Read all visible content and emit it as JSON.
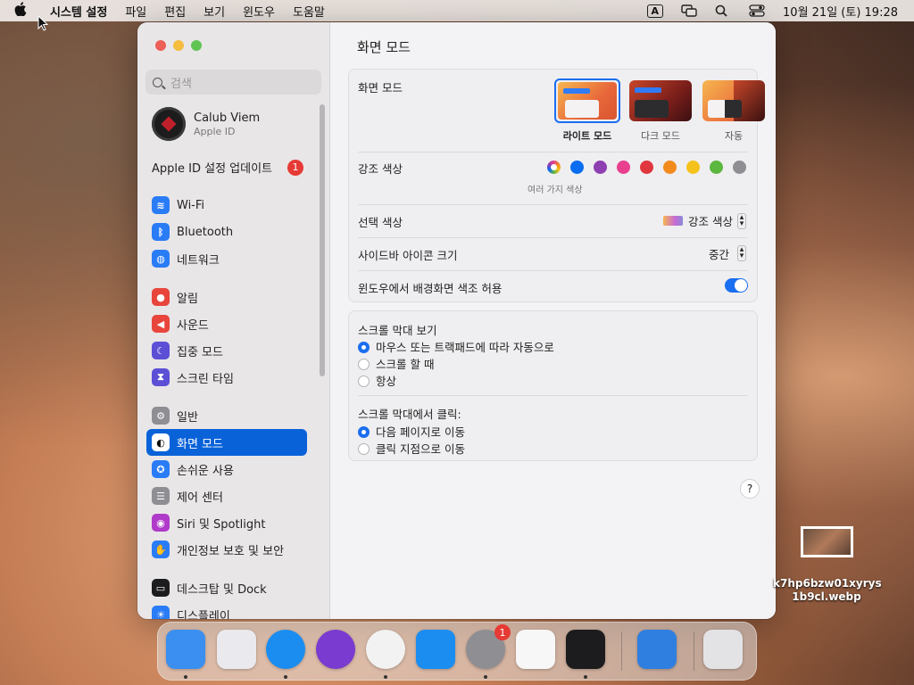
{
  "menubar": {
    "app_name": "시스템 설정",
    "menus": [
      "파일",
      "편집",
      "보기",
      "윈도우",
      "도움말"
    ],
    "keyboard_badge": "A",
    "clock": "10월 21일 (토) 19:28"
  },
  "sidebar": {
    "search_placeholder": "검색",
    "user": {
      "name": "Calub Viem",
      "sub": "Apple ID"
    },
    "update": {
      "label": "Apple ID 설정 업데이트",
      "badge": "1"
    },
    "items": [
      {
        "label": "Wi-Fi",
        "icon": "wifi-icon",
        "color": "#2a7cf6",
        "glyph": "≋"
      },
      {
        "label": "Bluetooth",
        "icon": "bluetooth-icon",
        "color": "#2a7cf6",
        "glyph": "ᛒ"
      },
      {
        "label": "네트워크",
        "icon": "network-icon",
        "color": "#2a7cf6",
        "glyph": "◍"
      },
      {
        "label": "알림",
        "icon": "notifications-icon",
        "color": "#e8453c",
        "glyph": "●"
      },
      {
        "label": "사운드",
        "icon": "sound-icon",
        "color": "#e8453c",
        "glyph": "◀"
      },
      {
        "label": "집중 모드",
        "icon": "focus-icon",
        "color": "#5c4fd6",
        "glyph": "☾"
      },
      {
        "label": "스크린 타임",
        "icon": "screen-time-icon",
        "color": "#5c4fd6",
        "glyph": "⧗"
      },
      {
        "label": "일반",
        "icon": "general-icon",
        "color": "#8e8e93",
        "glyph": "⚙"
      },
      {
        "label": "화면 모드",
        "icon": "appearance-icon",
        "color": "#111111",
        "glyph": "◐"
      },
      {
        "label": "손쉬운 사용",
        "icon": "accessibility-icon",
        "color": "#2a7cf6",
        "glyph": "✪"
      },
      {
        "label": "제어 센터",
        "icon": "control-center-icon",
        "color": "#8e8e93",
        "glyph": "☰"
      },
      {
        "label": "Siri 및 Spotlight",
        "icon": "siri-icon",
        "color": "#b03ac9",
        "glyph": "◉"
      },
      {
        "label": "개인정보 보호 및 보안",
        "icon": "privacy-icon",
        "color": "#2a7cf6",
        "glyph": "✋"
      },
      {
        "label": "데스크탑 및 Dock",
        "icon": "desktop-dock-icon",
        "color": "#1c1c1e",
        "glyph": "▭"
      },
      {
        "label": "디스플레이",
        "icon": "displays-icon",
        "color": "#2a7cf6",
        "glyph": "☀"
      }
    ],
    "active_index": 8
  },
  "content": {
    "title": "화면 모드",
    "appearance": {
      "label": "화면 모드",
      "options": [
        {
          "label": "라이트 모드",
          "selected": true
        },
        {
          "label": "다크 모드",
          "selected": false
        },
        {
          "label": "자동",
          "selected": false
        }
      ]
    },
    "accent": {
      "label": "강조 색상",
      "caption": "여러 가지 색상",
      "colors": [
        "multicolor",
        "#0a6cf0",
        "#8e3fb0",
        "#e83f8e",
        "#e0363d",
        "#f28b1c",
        "#f4c21b",
        "#5bb73f",
        "#8e8e93"
      ]
    },
    "highlight": {
      "label": "선택 색상",
      "value": "강조 색상"
    },
    "sidebar_icon_size": {
      "label": "사이드바 아이콘 크기",
      "value": "중간"
    },
    "wallpaper_tint": {
      "label": "윈도우에서 배경화면 색조 허용",
      "enabled": true
    },
    "scrollbars": {
      "label": "스크롤 막대 보기",
      "options": [
        "마우스 또는 트랙패드에 따라 자동으로",
        "스크롤 할 때",
        "항상"
      ],
      "selected": 0
    },
    "click_scrollbar": {
      "label": "스크롤 막대에서 클릭:",
      "options": [
        "다음 페이지로 이동",
        "클릭 지점으로 이동"
      ],
      "selected": 0
    },
    "help": "?"
  },
  "desktop_file": {
    "name_line1": "k7hp6bzw01xyrys",
    "name_line2": "1b9cl.webp"
  },
  "dock": {
    "apps": [
      {
        "name": "finder-icon",
        "color": "#3a8ff0",
        "running": true
      },
      {
        "name": "launchpad-icon",
        "color": "#e9e9ee",
        "running": false
      },
      {
        "name": "safari-icon",
        "color": "#1b8df0",
        "running": true
      },
      {
        "name": "firefox-icon",
        "color": "#7a3bd0",
        "running": false
      },
      {
        "name": "chrome-icon",
        "color": "#f2f2f2",
        "running": true
      },
      {
        "name": "app-store-icon",
        "color": "#1b8df0",
        "running": false
      },
      {
        "name": "system-settings-icon",
        "color": "#8e8e93",
        "running": true,
        "badge": "1"
      },
      {
        "name": "textedit-icon",
        "color": "#f7f7f7",
        "running": false
      },
      {
        "name": "terminal-icon",
        "color": "#1c1c1e",
        "running": true
      },
      {
        "name": "weather-icon",
        "color": "#2f7fe0",
        "running": false
      },
      {
        "name": "trash-icon",
        "color": "#e3e3e6",
        "running": false
      }
    ]
  }
}
